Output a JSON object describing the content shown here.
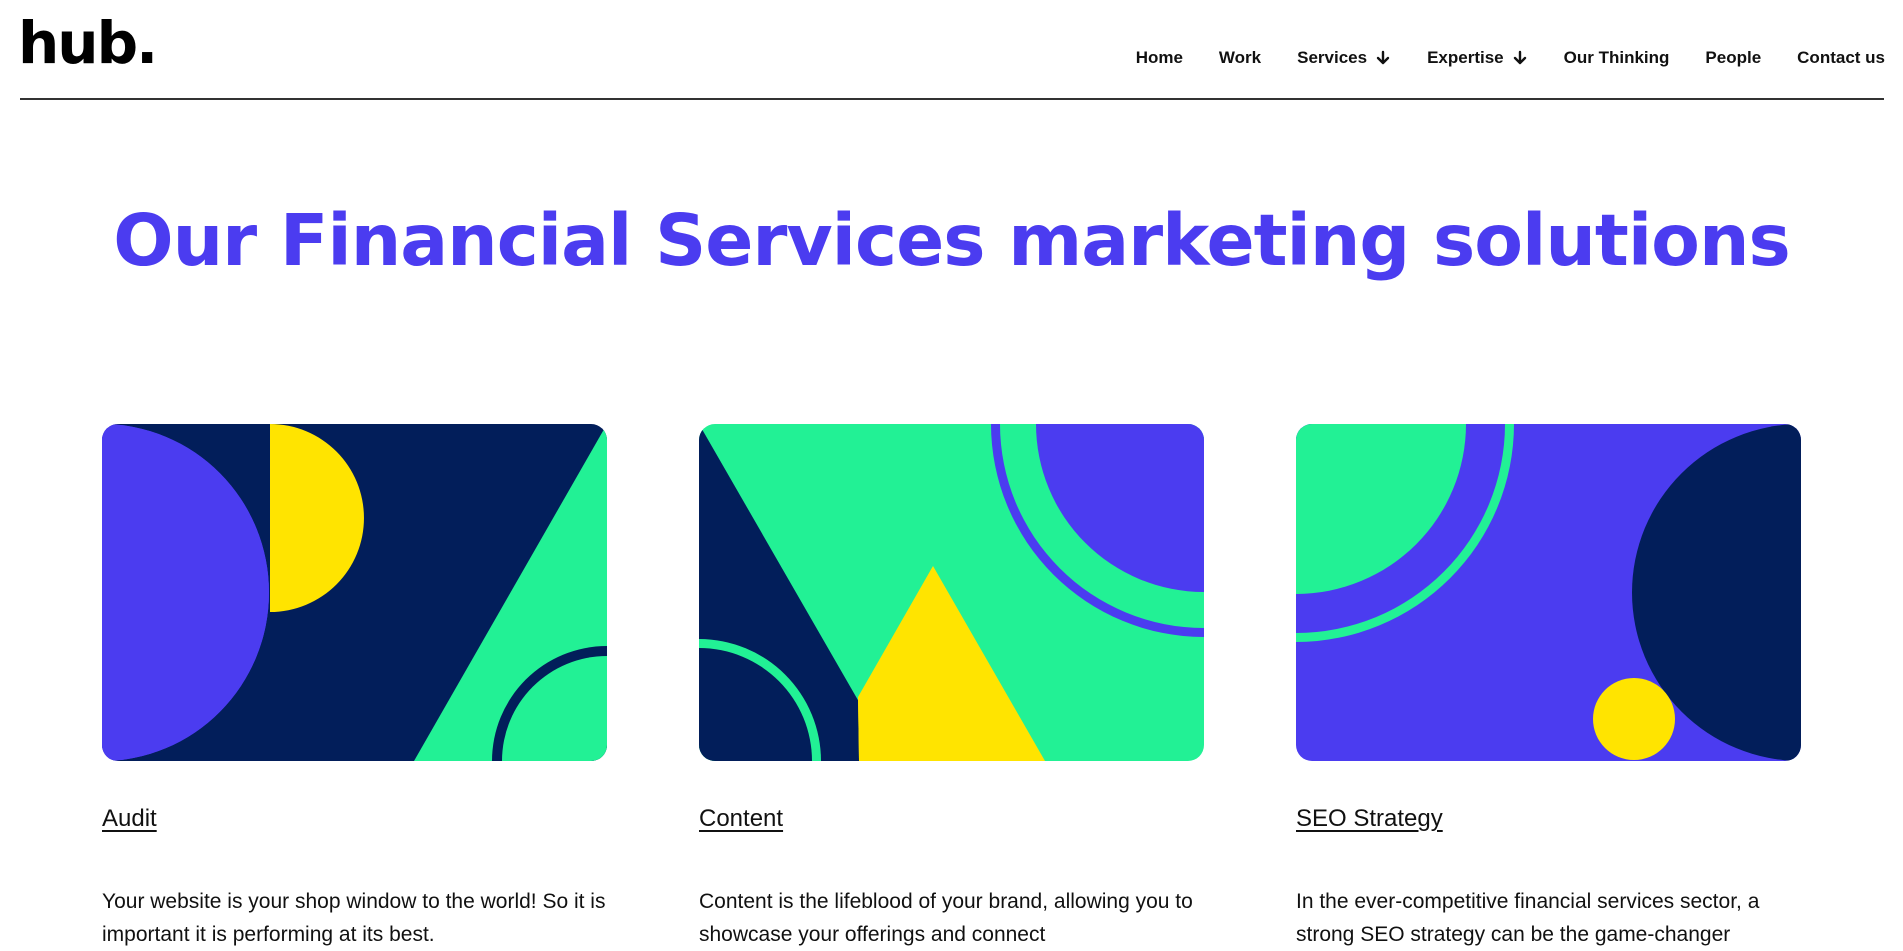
{
  "header": {
    "logo": "hub.",
    "nav": [
      {
        "label": "Home",
        "dropdown": false
      },
      {
        "label": "Work",
        "dropdown": false
      },
      {
        "label": "Services",
        "dropdown": true
      },
      {
        "label": "Expertise",
        "dropdown": true
      },
      {
        "label": "Our Thinking",
        "dropdown": false
      },
      {
        "label": "People",
        "dropdown": false
      },
      {
        "label": "Contact us",
        "dropdown": false
      }
    ]
  },
  "hero": {
    "title": "Our Financial Services marketing solutions"
  },
  "colors": {
    "brand_purple": "#4b3cf0",
    "navy": "#021e5a",
    "green": "#22f195",
    "yellow": "#ffe400"
  },
  "cards": [
    {
      "title": "Audit",
      "text": "Your website is your shop window to the world! So it is important it is performing at its best."
    },
    {
      "title": "Content",
      "text": "Content is the lifeblood of your brand, allowing you to showcase your offerings and connect"
    },
    {
      "title": "SEO Strategy",
      "text": "In the ever-competitive financial services sector, a strong SEO strategy can be the game-changer"
    }
  ]
}
